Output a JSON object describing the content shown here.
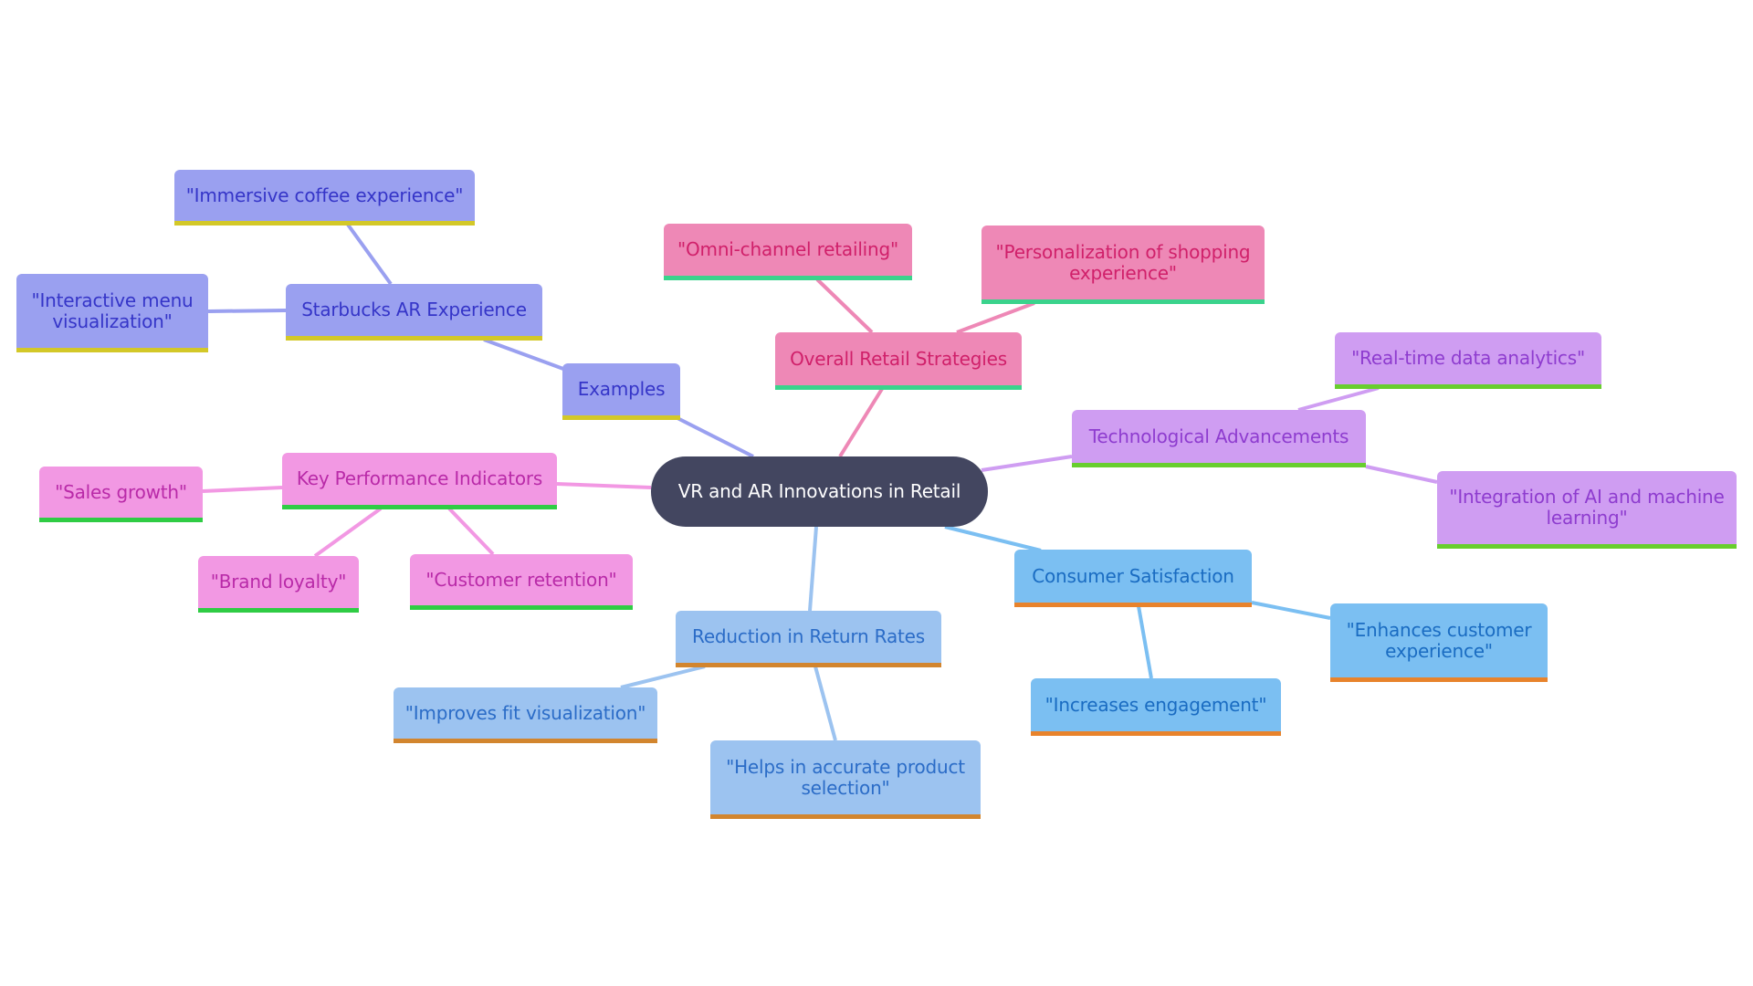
{
  "diagram": {
    "type": "mindmap",
    "root": "VR and AR Innovations in Retail",
    "colors": {
      "root": "#434660",
      "examples": "#9AA0F0",
      "strategies": "#EE88B6",
      "technology": "#CF9DF2",
      "kpi": "#F298E3",
      "consumer": "#7BBFF2",
      "returns": "#9CC3F0"
    },
    "branches": [
      {
        "key": "examples",
        "label": "Examples",
        "children": [
          {
            "key": "starbucks",
            "label": "Starbucks AR Experience",
            "children": [
              {
                "key": "immersive",
                "label": "\"Immersive coffee experience\""
              },
              {
                "key": "interactive",
                "label": "\"Interactive menu visualization\""
              }
            ]
          }
        ]
      },
      {
        "key": "strategies",
        "label": "Overall Retail Strategies",
        "children": [
          {
            "key": "omni",
            "label": "\"Omni-channel retailing\""
          },
          {
            "key": "personalization",
            "label": "\"Personalization of shopping experience\""
          }
        ]
      },
      {
        "key": "technology",
        "label": "Technological Advancements",
        "children": [
          {
            "key": "realtime",
            "label": "\"Real-time data analytics\""
          },
          {
            "key": "ai",
            "label": "\"Integration of AI and machine learning\""
          }
        ]
      },
      {
        "key": "kpi",
        "label": "Key Performance Indicators",
        "children": [
          {
            "key": "sales",
            "label": "\"Sales growth\""
          },
          {
            "key": "loyalty",
            "label": "\"Brand loyalty\""
          },
          {
            "key": "retention",
            "label": "\"Customer retention\""
          }
        ]
      },
      {
        "key": "consumer",
        "label": "Consumer Satisfaction",
        "children": [
          {
            "key": "enhances",
            "label": "\"Enhances customer experience\""
          },
          {
            "key": "engagement",
            "label": "\"Increases engagement\""
          }
        ]
      },
      {
        "key": "returns",
        "label": "Reduction in Return Rates",
        "children": [
          {
            "key": "fit",
            "label": "\"Improves fit visualization\""
          },
          {
            "key": "accurate",
            "label": "\"Helps in accurate product selection\""
          }
        ]
      }
    ]
  },
  "labels": {
    "root": "VR and AR Innovations in Retail",
    "examples": "Examples",
    "starbucks": "Starbucks AR Experience",
    "immersive": "\"Immersive coffee experience\"",
    "interactive": "\"Interactive menu visualization\"",
    "strategies": "Overall Retail Strategies",
    "omni": "\"Omni-channel retailing\"",
    "personalization": "\"Personalization of shopping experience\"",
    "technology": "Technological Advancements",
    "realtime": "\"Real-time data analytics\"",
    "ai": "\"Integration of AI and machine learning\"",
    "kpi": "Key Performance Indicators",
    "sales": "\"Sales growth\"",
    "loyalty": "\"Brand loyalty\"",
    "retention": "\"Customer retention\"",
    "consumer": "Consumer Satisfaction",
    "enhances": "\"Enhances customer experience\"",
    "engagement": "\"Increases engagement\"",
    "returns": "Reduction in Return Rates",
    "fit": "\"Improves fit visualization\"",
    "accurate": "\"Helps in accurate product selection\""
  }
}
